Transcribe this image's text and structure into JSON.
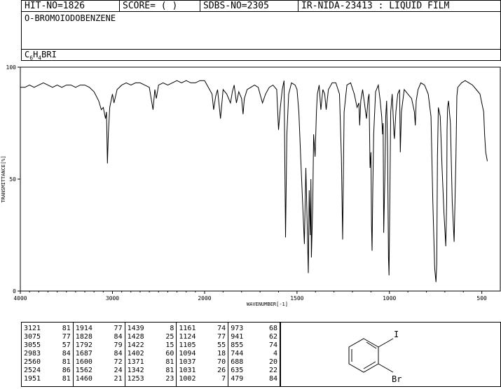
{
  "header": {
    "hit_no": "HIT-NO=1826",
    "score": "SCORE=  (   )",
    "sdbs_no": "SDBS-NO=2305",
    "ir_info": "IR-NIDA-23413 : LIQUID FILM"
  },
  "compound": {
    "name": "O-BROMOIODOBENZENE",
    "formula_parts": [
      "C",
      "6",
      "H",
      "4",
      "BRI"
    ]
  },
  "chart_data": {
    "type": "line",
    "xlabel": "WAVENUMBER[-1]",
    "ylabel": "TRANSMITTANCE[%]",
    "xlim": [
      4000,
      400
    ],
    "ylim": [
      0,
      100
    ],
    "xticks": [
      4000,
      3000,
      2000,
      1500,
      1000,
      500
    ],
    "yticks": [
      0,
      50,
      100
    ],
    "x": [
      4000,
      3950,
      3900,
      3850,
      3800,
      3750,
      3700,
      3650,
      3600,
      3550,
      3500,
      3450,
      3400,
      3350,
      3300,
      3250,
      3200,
      3150,
      3121,
      3100,
      3075,
      3065,
      3055,
      3045,
      3030,
      3000,
      2983,
      2950,
      2900,
      2850,
      2800,
      2750,
      2700,
      2650,
      2600,
      2560,
      2540,
      2524,
      2500,
      2450,
      2400,
      2350,
      2300,
      2250,
      2200,
      2150,
      2100,
      2050,
      2000,
      1980,
      1960,
      1951,
      1940,
      1930,
      1914,
      1900,
      1880,
      1860,
      1850,
      1840,
      1828,
      1815,
      1800,
      1792,
      1785,
      1770,
      1750,
      1730,
      1710,
      1700,
      1687,
      1670,
      1650,
      1630,
      1610,
      1600,
      1590,
      1580,
      1570,
      1562,
      1555,
      1545,
      1530,
      1510,
      1500,
      1490,
      1480,
      1470,
      1460,
      1452,
      1445,
      1439,
      1434,
      1428,
      1425,
      1422,
      1415,
      1410,
      1402,
      1395,
      1390,
      1380,
      1371,
      1360,
      1350,
      1342,
      1330,
      1310,
      1290,
      1270,
      1260,
      1253,
      1245,
      1230,
      1210,
      1190,
      1175,
      1165,
      1161,
      1155,
      1145,
      1135,
      1124,
      1115,
      1110,
      1105,
      1100,
      1097,
      1094,
      1090,
      1085,
      1075,
      1060,
      1050,
      1042,
      1037,
      1034,
      1031,
      1025,
      1020,
      1015,
      1010,
      1005,
      1002,
      998,
      993,
      985,
      975,
      973,
      965,
      955,
      945,
      941,
      935,
      920,
      900,
      880,
      865,
      860,
      855,
      845,
      830,
      810,
      790,
      775,
      765,
      755,
      748,
      744,
      740,
      735,
      725,
      715,
      705,
      695,
      690,
      688,
      685,
      680,
      670,
      660,
      650,
      640,
      635,
      630,
      620,
      610,
      590,
      570,
      550,
      530,
      510,
      500,
      490,
      485,
      479,
      470,
      455,
      440,
      420,
      400
    ],
    "y": [
      91,
      91,
      92,
      91,
      92,
      93,
      92,
      91,
      92,
      91,
      92,
      92,
      91,
      92,
      92,
      91,
      89,
      85,
      81,
      82,
      77,
      80,
      57,
      70,
      82,
      88,
      84,
      90,
      92,
      93,
      92,
      93,
      93,
      92,
      91,
      81,
      90,
      86,
      92,
      93,
      92,
      93,
      94,
      93,
      94,
      93,
      93,
      94,
      94,
      91,
      88,
      81,
      87,
      90,
      77,
      90,
      88,
      84,
      89,
      92,
      84,
      89,
      86,
      79,
      86,
      90,
      91,
      92,
      91,
      88,
      84,
      88,
      91,
      92,
      90,
      72,
      82,
      90,
      94,
      24,
      70,
      88,
      93,
      92,
      90,
      80,
      60,
      40,
      21,
      55,
      30,
      8,
      45,
      25,
      50,
      15,
      38,
      70,
      60,
      80,
      88,
      92,
      81,
      90,
      88,
      81,
      90,
      93,
      93,
      88,
      60,
      23,
      80,
      92,
      93,
      88,
      82,
      84,
      74,
      85,
      90,
      84,
      77,
      86,
      88,
      55,
      62,
      30,
      18,
      45,
      70,
      89,
      92,
      85,
      78,
      70,
      75,
      26,
      50,
      78,
      85,
      65,
      15,
      7,
      40,
      80,
      88,
      70,
      68,
      80,
      88,
      90,
      62,
      80,
      90,
      88,
      86,
      80,
      74,
      85,
      90,
      93,
      92,
      88,
      78,
      40,
      10,
      4,
      12,
      60,
      82,
      78,
      55,
      35,
      20,
      40,
      72,
      82,
      85,
      75,
      40,
      22,
      60,
      87,
      91,
      92,
      93,
      94,
      93,
      92,
      90,
      88,
      84,
      80,
      70,
      62,
      58
    ]
  },
  "peak_table": [
    [
      [
        "3121",
        "81"
      ],
      [
        "3075",
        "77"
      ],
      [
        "3055",
        "57"
      ],
      [
        "2983",
        "84"
      ],
      [
        "2560",
        "81"
      ],
      [
        "2524",
        "86"
      ],
      [
        "1951",
        "81"
      ]
    ],
    [
      [
        "1914",
        "77"
      ],
      [
        "1828",
        "84"
      ],
      [
        "1792",
        "79"
      ],
      [
        "1687",
        "84"
      ],
      [
        "1600",
        "72"
      ],
      [
        "1562",
        "24"
      ],
      [
        "1460",
        "21"
      ]
    ],
    [
      [
        "1439",
        "8"
      ],
      [
        "1428",
        "25"
      ],
      [
        "1422",
        "15"
      ],
      [
        "1402",
        "60"
      ],
      [
        "1371",
        "81"
      ],
      [
        "1342",
        "81"
      ],
      [
        "1253",
        "23"
      ]
    ],
    [
      [
        "1161",
        "74"
      ],
      [
        "1124",
        "77"
      ],
      [
        "1105",
        "55"
      ],
      [
        "1094",
        "18"
      ],
      [
        "1037",
        "70"
      ],
      [
        "1031",
        "26"
      ],
      [
        "1002",
        "7"
      ]
    ],
    [
      [
        "973",
        "68"
      ],
      [
        "941",
        "62"
      ],
      [
        "855",
        "74"
      ],
      [
        "744",
        "4"
      ],
      [
        "688",
        "20"
      ],
      [
        "635",
        "22"
      ],
      [
        "479",
        "84"
      ]
    ]
  ],
  "structure": {
    "label_top": "I",
    "label_bottom": "Br"
  }
}
